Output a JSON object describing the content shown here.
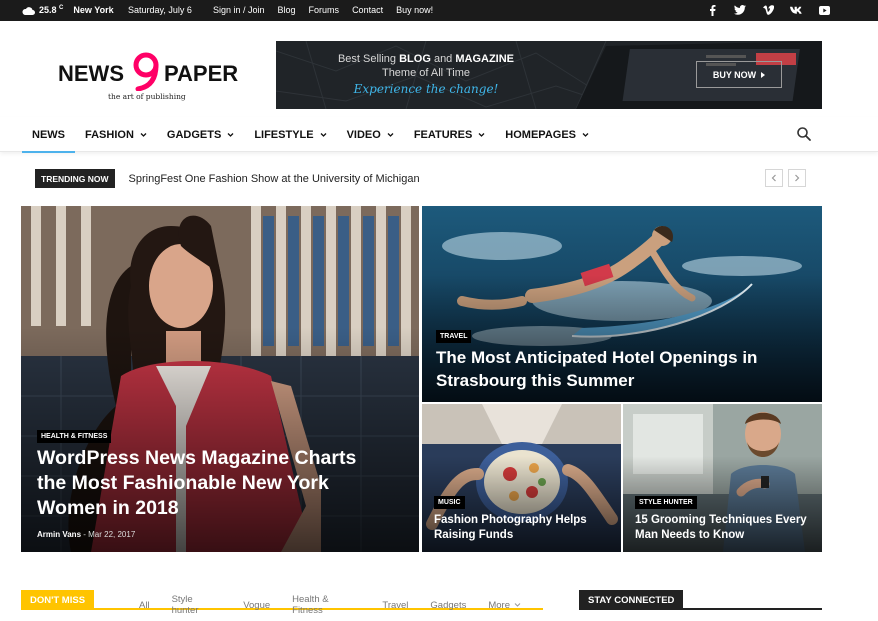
{
  "topbar": {
    "temperature": "25.8",
    "temp_unit": "C",
    "city": "New York",
    "date": "Saturday, July 6",
    "links": [
      "Sign in / Join",
      "Blog",
      "Forums",
      "Contact",
      "Buy now!"
    ],
    "social_icons": [
      "facebook-icon",
      "twitter-icon",
      "vimeo-icon",
      "vk-icon",
      "youtube-icon"
    ]
  },
  "logo": {
    "word1": "NEWS",
    "word2": "PAPER",
    "tagline": "the art of publishing",
    "accent": "#ff0066"
  },
  "banner": {
    "line1_pre": "Best Selling ",
    "line1_bold1": "BLOG",
    "line1_mid": " and ",
    "line1_bold2": "MAGAZINE",
    "line2": "Theme of All Time",
    "line3": "Experience the change!",
    "button": "BUY NOW"
  },
  "nav": {
    "items": [
      {
        "label": "NEWS",
        "dropdown": false
      },
      {
        "label": "FASHION",
        "dropdown": true
      },
      {
        "label": "GADGETS",
        "dropdown": true
      },
      {
        "label": "LIFESTYLE",
        "dropdown": true
      },
      {
        "label": "VIDEO",
        "dropdown": true
      },
      {
        "label": "FEATURES",
        "dropdown": true
      },
      {
        "label": "HOMEPAGES",
        "dropdown": true
      }
    ],
    "accent": "#4db2ec"
  },
  "trending": {
    "label": "TRENDING NOW",
    "text": "SpringFest One Fashion Show at the University of Michigan"
  },
  "grid": {
    "main": {
      "category": "HEALTH & FITNESS",
      "title": "WordPress News Magazine Charts the Most Fashionable New York Women in 2018",
      "author": "Armin Vans",
      "separator": " - ",
      "date": "Mar 22, 2017"
    },
    "top_right": {
      "category": "TRAVEL",
      "title": "The Most Anticipated Hotel Openings in Strasbourg this Summer"
    },
    "bottom_left": {
      "category": "MUSIC",
      "title": "Fashion Photography Helps Raising Funds"
    },
    "bottom_right": {
      "category": "STYLE HUNTER",
      "title": "15 Grooming Techniques Every Man Needs to Know"
    }
  },
  "dont_miss": {
    "label": "DON'T MISS",
    "tabs": [
      "All",
      "Style hunter",
      "Vogue",
      "Health & Fitness",
      "Travel",
      "Gadgets",
      "More"
    ],
    "accent": "#ffc400"
  },
  "stay_connected": {
    "label": "STAY CONNECTED"
  }
}
